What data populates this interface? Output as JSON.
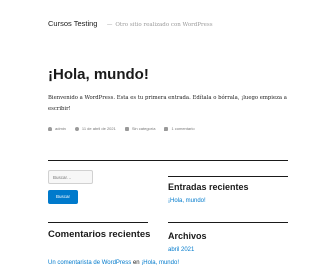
{
  "site": {
    "title": "Cursos Testing",
    "separator": "—",
    "description": "Otro sitio realizado con WordPress"
  },
  "post": {
    "title": "¡Hola, mundo!",
    "body": "Bienvenido a WordPress. Esta es tu primera entrada. Edítala o bórrala, ¡luego empieza a escribir!",
    "meta": {
      "author": "admin",
      "date": "11 de abril de 2021",
      "category": "Sin categoría",
      "comments": "1 comentario"
    }
  },
  "sidebar": {
    "search": {
      "placeholder": "Buscar…",
      "button_label": "Buscar"
    },
    "recent_posts": {
      "title": "Entradas recientes",
      "items": [
        "¡Hola, mundo!"
      ]
    },
    "recent_comments": {
      "title": "Comentarios recientes",
      "items": [
        {
          "author": "Un comentarista de WordPress",
          "connector": "en",
          "post": "¡Hola, mundo!"
        }
      ]
    },
    "archives": {
      "title": "Archivos",
      "items": [
        "abril 2021"
      ]
    }
  },
  "colors": {
    "link": "#007acc",
    "text": "#1a1a1a",
    "muted": "#767676",
    "button_bg": "#007acc"
  }
}
